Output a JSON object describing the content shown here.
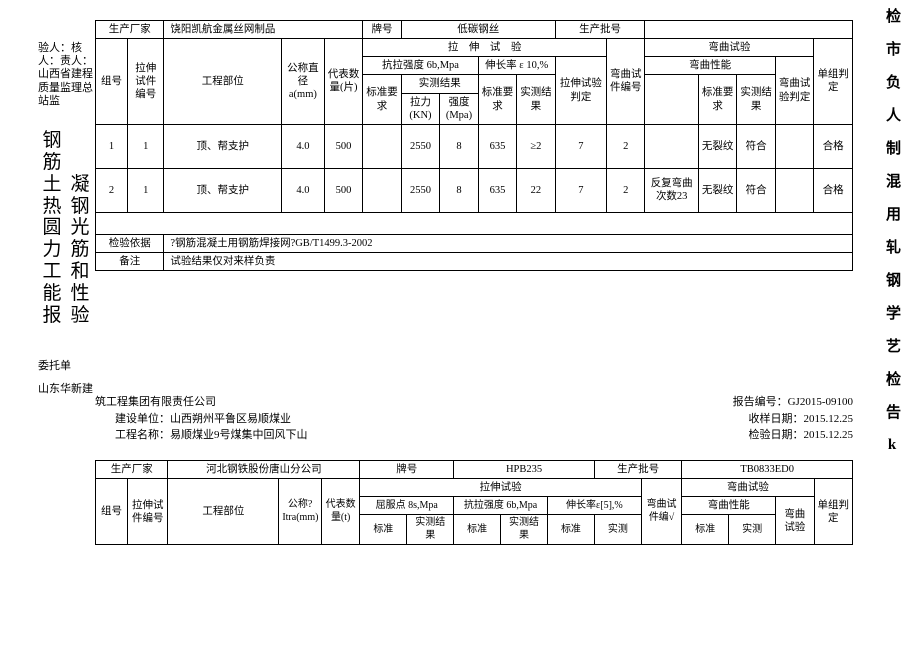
{
  "right_title": "检\n市\n负\n人\n制\n混\n用\n轧\n钢\n学\n艺\n检\n告\nk",
  "left": {
    "line1": "验人：核",
    "line2": "人：责人：",
    "line3": "山西省建程",
    "line4": "质量监理总",
    "line5": "站监",
    "big_col1": "钢筋土热圆力工能报",
    "big_col2": "凝钢光筋和性验",
    "bottom1": "委托单",
    "bottom2": "山东华新建"
  },
  "t1": {
    "row1": {
      "c1": "生产厂家",
      "c2": "饶阳凯航金属丝网制品",
      "c3": "牌号",
      "c4": "低碳钢丝",
      "c5": "生产批号",
      "c6": ""
    },
    "hdr": {
      "tensile_test": "拉　伸　试　验",
      "bend_test": "弯曲试验",
      "group_no": "组号",
      "piece_no": "拉伸试件编号",
      "part": "工程部位",
      "spec_diam": "公称直径a(mm)",
      "rep_qty": "代表数量(片)",
      "tensile_strength": "抗拉强度 6b,Mpa",
      "elongation": "伸长率 ε 10,%",
      "tensile_judge": "拉伸试验判定",
      "bend_piece_no": "弯曲试件编号",
      "bend_perf": "弯曲性能",
      "bend_judge": "弯曲试验判定",
      "group_judge": "单组判定",
      "std_req": "标准要求",
      "result": "实测结果",
      "force_kn": "拉力(KN)",
      "strength_mpa": "强度(Mpa)",
      "actual_res": "实测结果"
    },
    "rows": [
      {
        "group": "1",
        "pno": "1",
        "part": "顶、帮支护",
        "diam": "4.0",
        "qty": "500",
        "force": "2550",
        "strength": "8",
        "elong_std": "635",
        "elong_res": "≥2",
        "tjudge": "7",
        "bpno": "2",
        "bperf_hdr": "",
        "bstd": "无裂纹",
        "bres": "符合",
        "gj": "合格"
      },
      {
        "group": "2",
        "pno": "1",
        "part": "顶、帮支护",
        "diam": "4.0",
        "qty": "500",
        "force": "2550",
        "strength": "8",
        "elong_std": "635",
        "elong_res": "22",
        "tjudge": "7",
        "bpno": "2",
        "bperf_hdr": "反复弯曲次数23",
        "bstd": "无裂纹",
        "bres": "符合",
        "gj": "合格"
      }
    ],
    "basis_label": "检验依据",
    "basis": "?钢筋混凝土用钢筋焊接网?GB/T1499.3-2002",
    "remark_label": "备注",
    "remark": "试验结果仅对来样负责"
  },
  "info": {
    "l1": "筑工程集团有限责任公司",
    "r1_label": "报告编号：",
    "r1": "GJ2015-09100",
    "l2_label": "建设单位：",
    "l2": "山西朔州平鲁区易顺煤业",
    "r2_label": "收样日期：",
    "r2": "2015.12.25",
    "l3_label": "工程名称：",
    "l3": "易顺煤业9号煤集中回风下山",
    "r3_label": "检验日期：",
    "r3": "2015.12.25"
  },
  "t2": {
    "row1": {
      "c1": "生产厂家",
      "c2": "河北钢铁股份唐山分公司",
      "c3": "牌号",
      "c4": "HPB235",
      "c5": "生产批号",
      "c6": "TB0833ED0"
    },
    "hdr": {
      "group_no": "组号",
      "piece_no": "拉伸试件编号",
      "part": "工程部位",
      "spec": "公称?Itra(mm)",
      "qty": "代表数量(t)",
      "tensile_test": "拉伸试验",
      "bend_test": "弯曲试验",
      "group_judge": "单组判定",
      "yield": "屈服点 8s,Mpa",
      "tensile_str": "抗拉强度 6b,Mpa",
      "elong": "伸长率ε[5],%",
      "bpno": "弯曲试件编√",
      "bperf": "弯曲性能",
      "btest": "弯曲试验",
      "std": "标准",
      "actual": "实测结果",
      "actual2": "实测"
    }
  }
}
